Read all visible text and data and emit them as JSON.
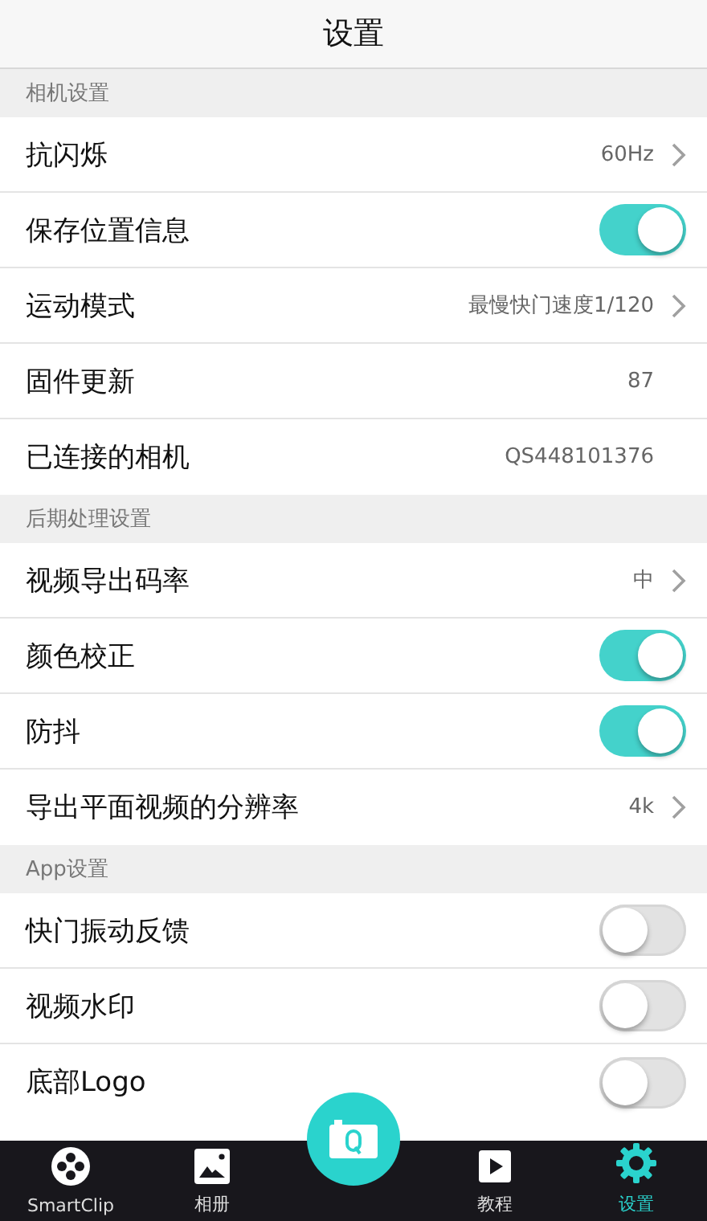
{
  "header": {
    "title": "设置"
  },
  "sections": [
    {
      "title": "相机设置",
      "rows": [
        {
          "kind": "link",
          "label": "抗闪烁",
          "value": "60Hz"
        },
        {
          "kind": "toggle",
          "label": "保存位置信息",
          "on": true
        },
        {
          "kind": "link",
          "label": "运动模式",
          "value": "最慢快门速度1/120"
        },
        {
          "kind": "value",
          "label": "固件更新",
          "value": "87"
        },
        {
          "kind": "value",
          "label": "已连接的相机",
          "value": "QS448101376"
        }
      ]
    },
    {
      "title": "后期处理设置",
      "rows": [
        {
          "kind": "link",
          "label": "视频导出码率",
          "value": "中"
        },
        {
          "kind": "toggle",
          "label": "颜色校正",
          "on": true
        },
        {
          "kind": "toggle",
          "label": "防抖",
          "on": true
        },
        {
          "kind": "link",
          "label": "导出平面视频的分辨率",
          "value": "4k"
        }
      ]
    },
    {
      "title": "App设置",
      "rows": [
        {
          "kind": "toggle",
          "label": "快门振动反馈",
          "on": false
        },
        {
          "kind": "toggle",
          "label": "视频水印",
          "on": false
        },
        {
          "kind": "toggle",
          "label": "底部Logo",
          "on": false
        }
      ]
    }
  ],
  "tab_bar": [
    {
      "kind": "film",
      "label": "SmartClip",
      "selected": false
    },
    {
      "kind": "photo",
      "label": "相册",
      "selected": false
    },
    {
      "kind": "camera"
    },
    {
      "kind": "book",
      "label": "教程",
      "selected": false
    },
    {
      "kind": "gear",
      "label": "设置",
      "selected": true
    }
  ]
}
